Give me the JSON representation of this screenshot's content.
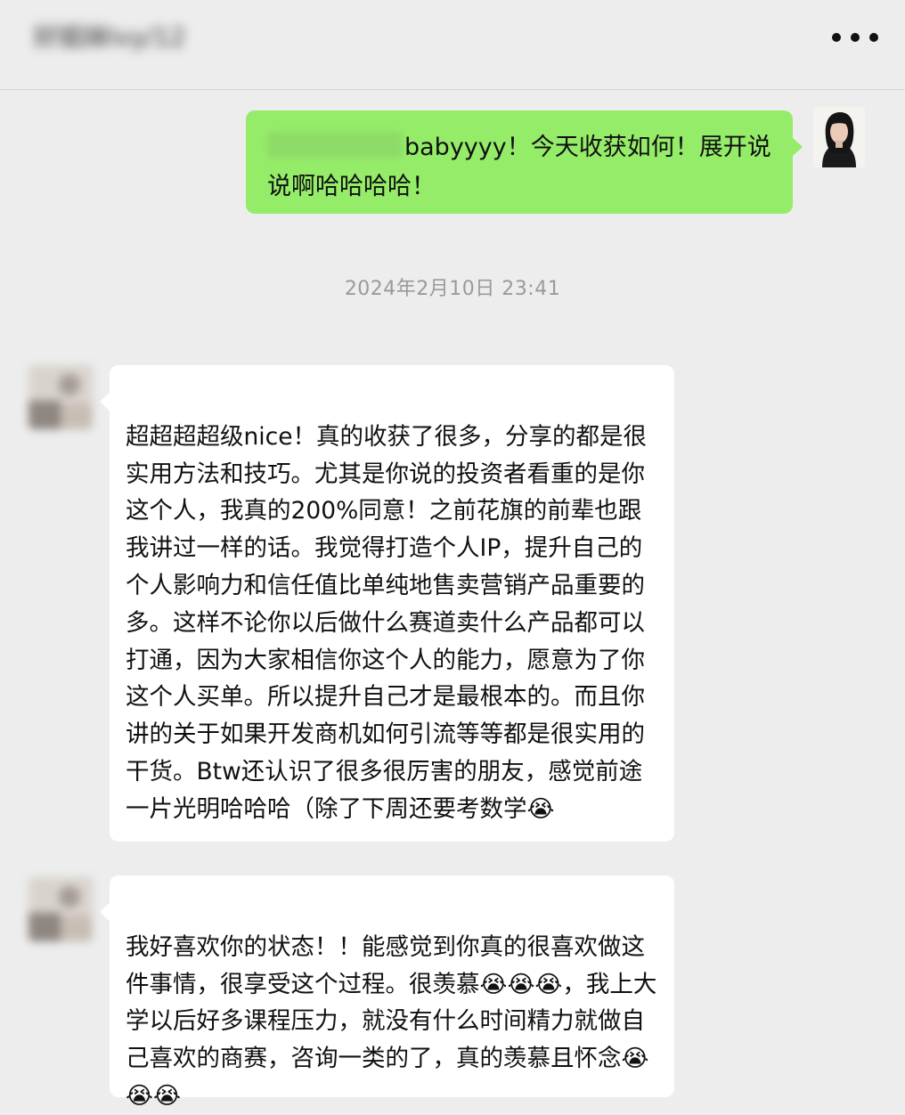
{
  "header": {
    "chat_title": "好姐妹Ivy/12",
    "more_icon": "more-dots-icon"
  },
  "messages": [
    {
      "direction": "out",
      "text": "babyyyy！今天收获如何！展开说说啊哈哈哈哈！",
      "avatar_icon": "user-avatar-photo"
    },
    {
      "direction": "in",
      "text": "超超超超级nice！真的收获了很多，分享的都是很实用方法和技巧。尤其是你说的投资者看重的是你这个人，我真的200%同意！之前花旗的前辈也跟我讲过一样的话。我觉得打造个人IP，提升自己的个人影响力和信任值比单纯地售卖营销产品重要的多。这样不论你以后做什么赛道卖什么产品都可以打通，因为大家相信你这个人的能力，愿意为了你这个人买单。所以提升自己才是最根本的。而且你讲的关于如果开发商机如何引流等等都是很实用的干货。Btw还认识了很多很厉害的朋友，感觉前途一片光明哈哈哈（除了下周还要考数学😭",
      "avatar_icon": "contact-avatar-blurred"
    },
    {
      "direction": "in",
      "text": "我好喜欢你的状态！！能感觉到你真的很喜欢做这件事情，很享受这个过程。很羡慕😭😭😭，我上大学以后好多课程压力，就没有什么时间精力就做自己喜欢的商赛，咨询一类的了，真的羡慕且怀念😭😭😭",
      "avatar_icon": "contact-avatar-blurred"
    }
  ],
  "timestamp": "2024年2月10日 23:41",
  "colors": {
    "background": "#ededed",
    "outgoing_bubble": "#95ec69",
    "incoming_bubble": "#ffffff",
    "timestamp_text": "#9a9a9a"
  }
}
